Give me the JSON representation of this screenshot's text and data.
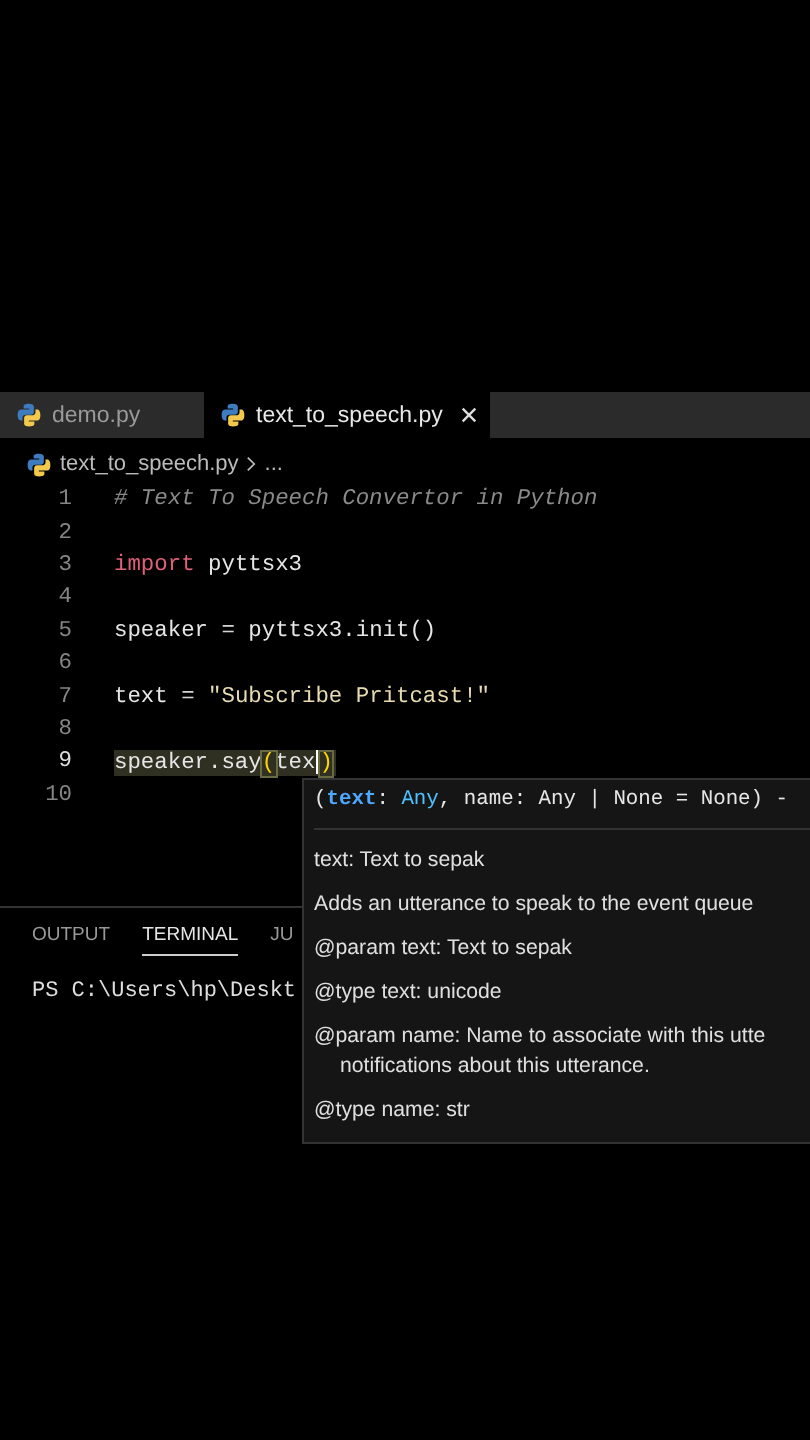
{
  "tabs": [
    {
      "label": "demo.py",
      "selected": false
    },
    {
      "label": "text_to_speech.py",
      "selected": true
    }
  ],
  "breadcrumb": {
    "file": "text_to_speech.py",
    "more": "..."
  },
  "code_lines": [
    {
      "number": "1",
      "current": false,
      "tokens": [
        {
          "kind": "comment",
          "text": "# Text To Speech Convertor in Python"
        }
      ]
    },
    {
      "number": "2",
      "current": false
    },
    {
      "number": "3",
      "current": false,
      "tokens": [
        {
          "kind": "keyword",
          "text": "import"
        },
        {
          "kind": "plain",
          "text": " pyttsx3"
        }
      ]
    },
    {
      "number": "4",
      "current": false
    },
    {
      "number": "5",
      "current": false,
      "tokens": [
        {
          "kind": "plain",
          "text": "speaker "
        },
        {
          "kind": "operator",
          "text": "="
        },
        {
          "kind": "plain",
          "text": " pyttsx3.init()"
        }
      ]
    },
    {
      "number": "6",
      "current": false
    },
    {
      "number": "7",
      "current": false,
      "tokens": [
        {
          "kind": "plain",
          "text": "text "
        },
        {
          "kind": "operator",
          "text": "="
        },
        {
          "kind": "string",
          "text": " \"Subscribe Pritcast!\""
        }
      ]
    },
    {
      "number": "8",
      "current": false
    },
    {
      "number": "9",
      "current": true,
      "tokens": [
        {
          "kind": "plain",
          "text": "speaker.say"
        },
        {
          "kind": "bracket",
          "text": "("
        },
        {
          "kind": "plain",
          "text": "tex"
        },
        {
          "kind": "cursor"
        },
        {
          "kind": "bracket",
          "text": ")"
        }
      ]
    },
    {
      "number": "10",
      "current": false
    }
  ],
  "panel_tabs": [
    {
      "label": "OUTPUT",
      "selected": false
    },
    {
      "label": "TERMINAL",
      "selected": true
    },
    {
      "label": "JU",
      "selected": false
    }
  ],
  "terminal_line": "PS C:\\Users\\hp\\Deskt",
  "hover": {
    "signature": [
      {
        "kind": "punct",
        "text": "("
      },
      {
        "kind": "param",
        "text": "text"
      },
      {
        "kind": "punct",
        "text": ": "
      },
      {
        "kind": "type",
        "text": "Any"
      },
      {
        "kind": "punct",
        "text": ", name: Any | None = None) -"
      }
    ],
    "docs": [
      {
        "kind": "line",
        "text": "text: Text to sepak"
      },
      {
        "kind": "line",
        "text": "Adds an utterance to speak to the event queue"
      },
      {
        "kind": "line",
        "text": "@param text: Text to sepak"
      },
      {
        "kind": "line",
        "text": "@type text: unicode"
      },
      {
        "kind": "wrapped",
        "text": "@param name: Name to associate with this utte",
        "continuation": "notifications about this utterance."
      },
      {
        "kind": "line",
        "text": "@type name: str"
      }
    ]
  }
}
